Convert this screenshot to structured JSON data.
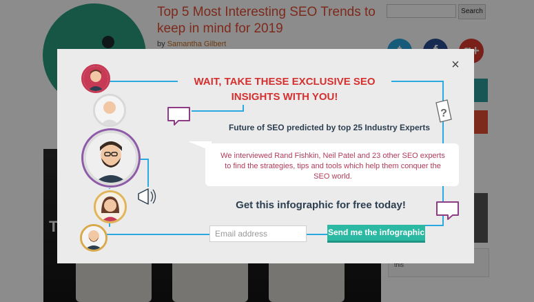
{
  "background": {
    "article_title": "Top 5 Most Interesting SEO Trends to keep in mind for 2019",
    "byline_prefix": "by",
    "author": "Samantha Gilbert",
    "search_button": "Search",
    "social_twitter": "t",
    "social_facebook": "f",
    "social_gplus": "g+",
    "photo_letter": "T",
    "widget_text": "this"
  },
  "modal": {
    "close_glyph": "×",
    "headline_line1": "WAIT, TAKE THESE EXCLUSIVE SEO",
    "headline_line2": "INSIGHTS WITH YOU!",
    "subheadline": "Future of SEO predicted by top 25 Industry Experts",
    "bubble_text": "We interviewed Rand Fishkin, Neil Patel and 23 other SEO experts to find the strategies, tips and tools which help them conquer the SEO world.",
    "cta": "Get this infographic for free today!",
    "email_placeholder": "Email address",
    "send_button": "Send me the infographic"
  },
  "colors": {
    "headline": "#d3302f",
    "accent_teal": "#2bb9a3",
    "circuit_blue": "#2aa9e0",
    "bubble_text": "#b23a5a"
  },
  "icons": [
    "close-icon",
    "speech-bubble-icon",
    "question-mark-icon",
    "megaphone-icon",
    "twitter-icon",
    "facebook-icon",
    "google-plus-icon"
  ]
}
